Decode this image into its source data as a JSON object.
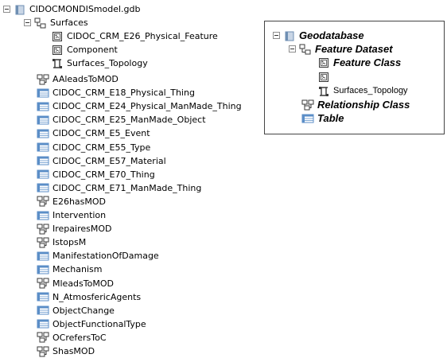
{
  "tree": {
    "root_label": "CIDOCMONDISmodel.gdb",
    "dataset_label": "Surfaces",
    "dataset_children": [
      {
        "label": "CIDOC_CRM_E26_Physical_Feature",
        "icon": "feature-class-icon"
      },
      {
        "label": "Component",
        "icon": "feature-class-icon"
      },
      {
        "label": "Surfaces_Topology",
        "icon": "topology-icon"
      }
    ],
    "items": [
      {
        "label": "AAleadsToMOD",
        "icon": "relationship-class-icon"
      },
      {
        "label": "CIDOC_CRM_E18_Physical_Thing",
        "icon": "table-icon"
      },
      {
        "label": "CIDOC_CRM_E24_Physical_ManMade_Thing",
        "icon": "table-icon"
      },
      {
        "label": "CIDOC_CRM_E25_ManMade_Object",
        "icon": "table-icon"
      },
      {
        "label": "CIDOC_CRM_E5_Event",
        "icon": "table-icon"
      },
      {
        "label": "CIDOC_CRM_E55_Type",
        "icon": "table-icon"
      },
      {
        "label": "CIDOC_CRM_E57_Material",
        "icon": "table-icon"
      },
      {
        "label": "CIDOC_CRM_E70_Thing",
        "icon": "table-icon"
      },
      {
        "label": "CIDOC_CRM_E71_ManMade_Thing",
        "icon": "table-icon"
      },
      {
        "label": "E26hasMOD",
        "icon": "relationship-class-icon"
      },
      {
        "label": "Intervention",
        "icon": "table-icon"
      },
      {
        "label": "IrepairesMOD",
        "icon": "relationship-class-icon"
      },
      {
        "label": "IstopsM",
        "icon": "relationship-class-icon"
      },
      {
        "label": "ManifestationOfDamage",
        "icon": "table-icon"
      },
      {
        "label": "Mechanism",
        "icon": "table-icon"
      },
      {
        "label": "MleadsToMOD",
        "icon": "relationship-class-icon"
      },
      {
        "label": "N_AtmosfericAgents",
        "icon": "table-icon"
      },
      {
        "label": "ObjectChange",
        "icon": "table-icon"
      },
      {
        "label": "ObjectFunctionalType",
        "icon": "table-icon"
      },
      {
        "label": "OCrefersToC",
        "icon": "relationship-class-icon"
      },
      {
        "label": "ShasMOD",
        "icon": "relationship-class-icon"
      }
    ]
  },
  "legend": {
    "geodatabase": "Geodatabase",
    "feature_dataset": "Feature Dataset",
    "feature_class": "Feature Class",
    "topology": "Surfaces_Topology",
    "relationship_class": "Relationship Class",
    "table": "Table"
  },
  "colors": {
    "table_icon": "#5b8ec7",
    "database_icon": "#6f8fb3",
    "icon_stroke": "#3a3a3a"
  }
}
